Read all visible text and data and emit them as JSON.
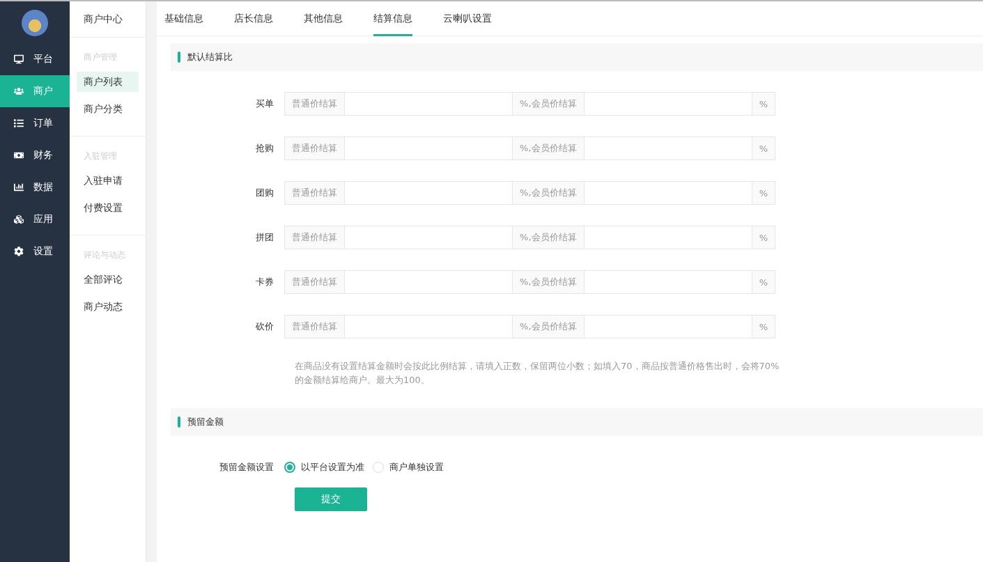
{
  "nav": [
    {
      "label": "平台",
      "selected": false
    },
    {
      "label": "商户",
      "selected": true
    },
    {
      "label": "订单",
      "selected": false
    },
    {
      "label": "财务",
      "selected": false
    },
    {
      "label": "数据",
      "selected": false
    },
    {
      "label": "应用",
      "selected": false
    },
    {
      "label": "设置",
      "selected": false
    }
  ],
  "subnav": {
    "title": "商户中心",
    "groups": [
      {
        "heading": "商户管理",
        "items": [
          {
            "label": "商户列表",
            "selected": true
          },
          {
            "label": "商户分类",
            "selected": false
          }
        ]
      },
      {
        "heading": "入驻管理",
        "items": [
          {
            "label": "入驻申请",
            "selected": false
          },
          {
            "label": "付费设置",
            "selected": false
          }
        ]
      },
      {
        "heading": "评论与动态",
        "items": [
          {
            "label": "全部评论",
            "selected": false
          },
          {
            "label": "商户动态",
            "selected": false
          }
        ]
      }
    ]
  },
  "tabs": [
    {
      "label": "基础信息",
      "selected": false
    },
    {
      "label": "店长信息",
      "selected": false
    },
    {
      "label": "其他信息",
      "selected": false
    },
    {
      "label": "结算信息",
      "selected": true
    },
    {
      "label": "云喇叭设置",
      "selected": false
    }
  ],
  "ratio_section": {
    "title": "默认结算比",
    "rows": [
      {
        "label": "买单",
        "addon_1": "普通价结算",
        "addon_2": "%,会员价结算",
        "addon_3": "%"
      },
      {
        "label": "抢购",
        "addon_1": "普通价结算",
        "addon_2": "%,会员价结算",
        "addon_3": "%"
      },
      {
        "label": "团购",
        "addon_1": "普通价结算",
        "addon_2": "%,会员价结算",
        "addon_3": "%"
      },
      {
        "label": "拼团",
        "addon_1": "普通价结算",
        "addon_2": "%,会员价结算",
        "addon_3": "%"
      },
      {
        "label": "卡券",
        "addon_1": "普通价结算",
        "addon_2": "%,会员价结算",
        "addon_3": "%"
      },
      {
        "label": "砍价",
        "addon_1": "普通价结算",
        "addon_2": "%,会员价结算",
        "addon_3": "%"
      }
    ],
    "hint": "在商品没有设置结算金额时会按此比例结算，请填入正数，保留两位小数；如填入70，商品按普通价格售出时，会将70%的金额结算给商户。最大为100。"
  },
  "reserve_section": {
    "title": "预留金额",
    "label": "预留金额设置",
    "options": [
      {
        "label": "以平台设置为准",
        "selected": true
      },
      {
        "label": "商户单独设置",
        "selected": false
      }
    ]
  },
  "submit": "提交"
}
